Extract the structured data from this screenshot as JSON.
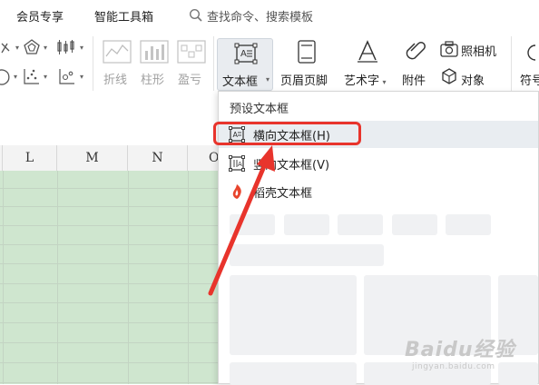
{
  "menubar": {
    "items": [
      "会员专享",
      "智能工具箱"
    ],
    "search_placeholder": "查找命令、搜索模板"
  },
  "ribbon": {
    "sparkline_group": [
      "折线",
      "柱形",
      "盈亏"
    ],
    "buttons": {
      "textbox": "文本框",
      "header_footer": "页眉页脚",
      "wordart": "艺术字",
      "attachment": "附件",
      "camera": "照相机",
      "object": "对象",
      "symbol": "符号"
    }
  },
  "sheet": {
    "columns": [
      "L",
      "M",
      "N",
      "O"
    ],
    "cell_color": "#cfe6cf"
  },
  "dropdown": {
    "header": "预设文本框",
    "items": [
      {
        "label": "横向文本框(H)",
        "highlighted": true
      },
      {
        "label": "竖向文本框(V)",
        "highlighted": false
      },
      {
        "label": "稻壳文本框",
        "highlighted": false
      }
    ]
  },
  "annotation": {
    "highlight_color": "#e8342c"
  },
  "watermark": {
    "main": "Baidu经验",
    "sub": "jingyan.baidu.com"
  }
}
